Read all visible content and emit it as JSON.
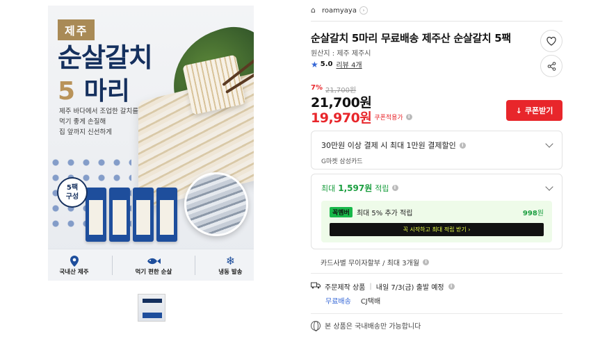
{
  "hero": {
    "origin_tag": "제주",
    "title": "순살갈치",
    "count_num": "5",
    "count_word": "마리",
    "copy": [
      "제주 바다에서 조업한 갈치를",
      "먹기 좋게 손질해",
      "집 앞까지 신선하게"
    ],
    "pack_badge_line1": "5팩",
    "pack_badge_line2": "구성",
    "features": [
      {
        "icon": "location-pin-icon",
        "label": "국내산 제주"
      },
      {
        "icon": "fish-icon",
        "label": "먹기 편한 순살"
      },
      {
        "icon": "snowflake-icon",
        "label": "냉동 발송"
      }
    ]
  },
  "store": {
    "name": "roamyaya"
  },
  "product": {
    "title": "순살갈치 5마리 무료배송 제주산 순살갈치 5팩",
    "origin": "원산지 : 제주 제주시",
    "rating": "5.0",
    "review_label": "리뷰 4개"
  },
  "price": {
    "discount_pct": "7%",
    "original": "21,700원",
    "main": "21,700원",
    "coupon_price": "19,970원",
    "coupon_label": "쿠폰적용가",
    "coupon_button": "쿠폰받기"
  },
  "card_offer": {
    "title": "30만원 이상 결제 시 최대 1만원 결제할인",
    "subtitle": "G마켓 삼성카드"
  },
  "points": {
    "prefix": "최대",
    "amount": "1,597원",
    "suffix": "적립",
    "badge_a": "꼭",
    "badge_b": "멤버",
    "extra_text": "최대 5% 추가 적립",
    "extra_amount": "998",
    "extra_unit": "원",
    "join_button": "꼭 시작하고 최대 적립 받기  ›"
  },
  "installment": "카드사별 무이자할부 / 최대 3개월",
  "shipping": {
    "label": "주문제작 상품",
    "schedule": "내일 7/3(금) 출발 예정",
    "free": "무료배송",
    "carrier": "CJ택배"
  },
  "domestic_note": "본 상품은 국내배송만 가능합니다",
  "colors": {
    "accent_red": "#e8262b",
    "brand_navy": "#15305e",
    "green": "#1a9e3f",
    "blue": "#3466d6"
  }
}
